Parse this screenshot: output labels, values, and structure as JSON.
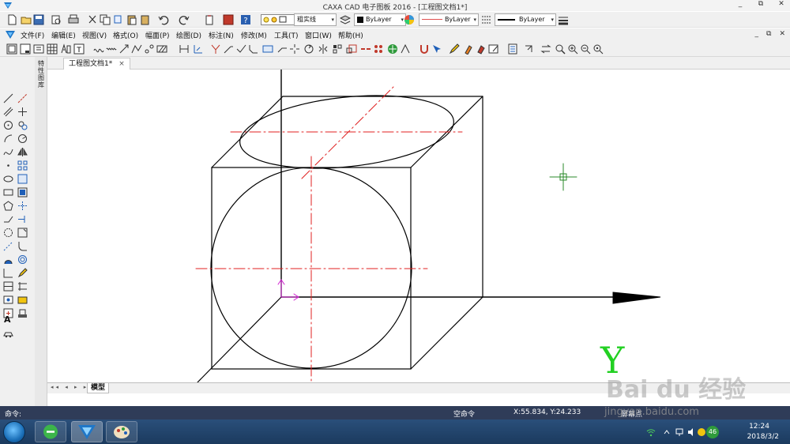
{
  "window": {
    "title": "CAXA CAD 电子图板 2016 - [工程图文档1*]",
    "controls": [
      "_",
      "⧉",
      "✕"
    ]
  },
  "toolbar1": {
    "linetype_dropdown": "粗实线",
    "color_dropdown": "ByLayer",
    "linestyle_dropdown": "ByLayer",
    "lineweight_dropdown": "ByLayer",
    "colors": {
      "color_swatch": "#0a0a0a",
      "linestyle_sample": "#e05050"
    }
  },
  "menubar": {
    "items": [
      "文件(F)",
      "编辑(E)",
      "视图(V)",
      "格式(O)",
      "幅面(P)",
      "绘图(D)",
      "标注(N)",
      "修改(M)",
      "工具(T)",
      "窗口(W)",
      "帮助(H)"
    ],
    "mdi_controls": [
      "_",
      "⧉",
      "✕"
    ]
  },
  "dock": {
    "label": "特性 图库"
  },
  "left_panel": {
    "text_tool": "A"
  },
  "document_tab": {
    "label": "工程图文档1*",
    "close": "×"
  },
  "canvas": {
    "axis_label": "Y",
    "colors": {
      "axis_label": "#22d022",
      "centerline": "#e02020",
      "ucs": "#d020d0",
      "crosshair": "#2a8a2a",
      "geometry": "#000000"
    }
  },
  "sheetbar": {
    "nav": "◂◂ ◂ ▸ ▸▸",
    "model_tab": "模型"
  },
  "statusbar": {
    "prompt": "命令:",
    "command": "空命令",
    "coords": "X:55.834, Y:24.233",
    "mode": "屏幕点"
  },
  "taskbar": {
    "time": "12:24",
    "date": "2018/3/2",
    "badge": "46"
  },
  "watermark": {
    "main": "Bai du 经验",
    "sub": "jingyan.baidu.com"
  }
}
